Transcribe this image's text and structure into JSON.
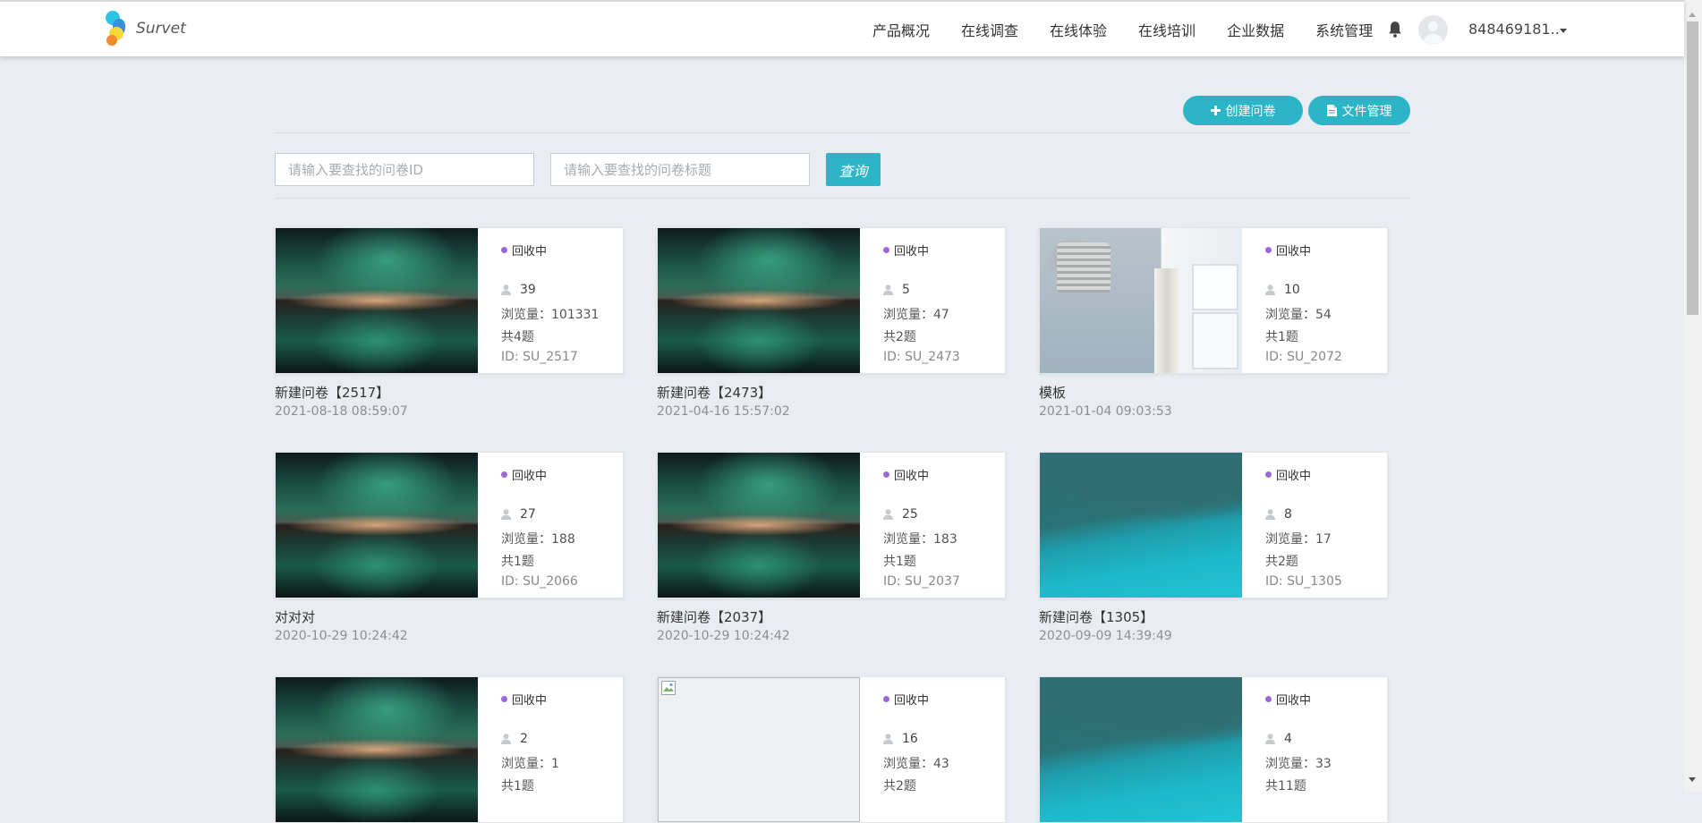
{
  "header": {
    "brand": "Survet",
    "nav": [
      "产品概况",
      "在线调查",
      "在线体验",
      "在线培训",
      "企业数据",
      "系统管理"
    ],
    "username": "848469181.."
  },
  "toolbar": {
    "create_label": "创建问卷",
    "files_label": "文件管理"
  },
  "search": {
    "id_placeholder": "请输入要查找的问卷ID",
    "title_placeholder": "请输入要查找的问卷标题",
    "query_label": "查询"
  },
  "surveys": [
    {
      "status": "回收中",
      "responses": "39",
      "views": "浏览量：101331",
      "questions": "共4题",
      "id": "ID: SU_2517",
      "title": "新建问卷【2517】",
      "date": "2021-08-18 08:59:07",
      "image": "aurora"
    },
    {
      "status": "回收中",
      "responses": "5",
      "views": "浏览量：47",
      "questions": "共2题",
      "id": "ID: SU_2473",
      "title": "新建问卷【2473】",
      "date": "2021-04-16 15:57:02",
      "image": "aurora"
    },
    {
      "status": "回收中",
      "responses": "10",
      "views": "浏览量：54",
      "questions": "共1题",
      "id": "ID: SU_2072",
      "title": "模板",
      "date": "2021-01-04 09:03:53",
      "image": "room"
    },
    {
      "status": "回收中",
      "responses": "27",
      "views": "浏览量：188",
      "questions": "共1题",
      "id": "ID: SU_2066",
      "title": "对对对",
      "date": "2020-10-29 10:24:42",
      "image": "aurora"
    },
    {
      "status": "回收中",
      "responses": "25",
      "views": "浏览量：183",
      "questions": "共1题",
      "id": "ID: SU_2037",
      "title": "新建问卷【2037】",
      "date": "2020-10-29 10:24:42",
      "image": "aurora"
    },
    {
      "status": "回收中",
      "responses": "8",
      "views": "浏览量：17",
      "questions": "共2题",
      "id": "ID: SU_1305",
      "title": "新建问卷【1305】",
      "date": "2020-09-09 14:39:49",
      "image": "sea"
    },
    {
      "status": "回收中",
      "responses": "2",
      "views": "浏览量：1",
      "questions": "共1题",
      "image": "aurora"
    },
    {
      "status": "回收中",
      "responses": "16",
      "views": "浏览量：43",
      "questions": "共2题",
      "image": "blank"
    },
    {
      "status": "回收中",
      "responses": "4",
      "views": "浏览量：33",
      "questions": "共11题",
      "image": "sea"
    }
  ]
}
